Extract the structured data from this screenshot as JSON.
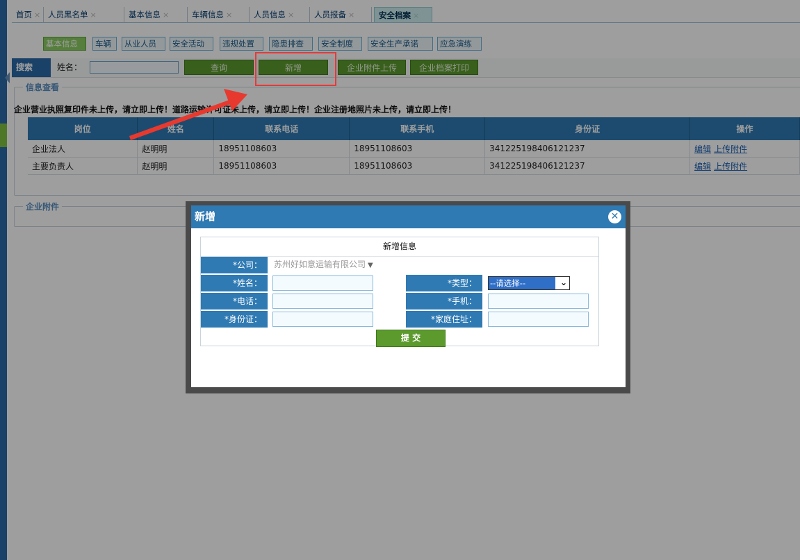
{
  "tabs": [
    {
      "label": "首页",
      "active": false
    },
    {
      "label": "人员黑名单",
      "active": false
    },
    {
      "label": "基本信息",
      "active": false
    },
    {
      "label": "车辆信息",
      "active": false
    },
    {
      "label": "人员信息",
      "active": false
    },
    {
      "label": "人员报备",
      "active": false
    },
    {
      "label": "安全档案",
      "active": true
    }
  ],
  "subtabs": [
    "基本信息",
    "车辆",
    "从业人员",
    "安全活动",
    "违规处置",
    "隐患排查",
    "安全制度",
    "安全生产承诺",
    "应急演练"
  ],
  "search": {
    "label": "搜索",
    "name_label": "姓名：",
    "name_value": "",
    "query_button": "查询",
    "add_button": "新增",
    "upload_button": "企业附件上传",
    "print_button": "企业档案打印"
  },
  "info_section": {
    "legend": "信息查看",
    "notice": "企业营业执照复印件未上传，请立即上传！道路运输许可证未上传，请立即上传！企业注册地照片未上传，请立即上传！",
    "columns": [
      "岗位",
      "姓名",
      "联系电话",
      "联系手机",
      "身份证",
      "操作"
    ],
    "rows": [
      {
        "post": "企业法人",
        "name": "赵明明",
        "phone": "18951108603",
        "mobile": "18951108603",
        "id": "341225198406121237",
        "edit": "编辑",
        "upload": "上传附件"
      },
      {
        "post": "主要负责人",
        "name": "赵明明",
        "phone": "18951108603",
        "mobile": "18951108603",
        "id": "341225198406121237",
        "edit": "编辑",
        "upload": "上传附件"
      }
    ]
  },
  "attachment_section": {
    "legend": "企业附件"
  },
  "modal": {
    "title": "新增",
    "form_title": "新增信息",
    "company_label": "*公司：",
    "company_value": "苏州好如意运输有限公司",
    "name_label": "*姓名：",
    "type_label": "*类型：",
    "type_value": "--请选择--",
    "phone_label": "*电话：",
    "mobile_label": "*手机：",
    "id_label": "*身份证：",
    "address_label": "*家庭住址：",
    "submit_label": "提 交"
  },
  "colors": {
    "header_blue": "#2f7ab3",
    "button_green": "#5c9a2e",
    "highlight_red": "#e53a3a"
  }
}
